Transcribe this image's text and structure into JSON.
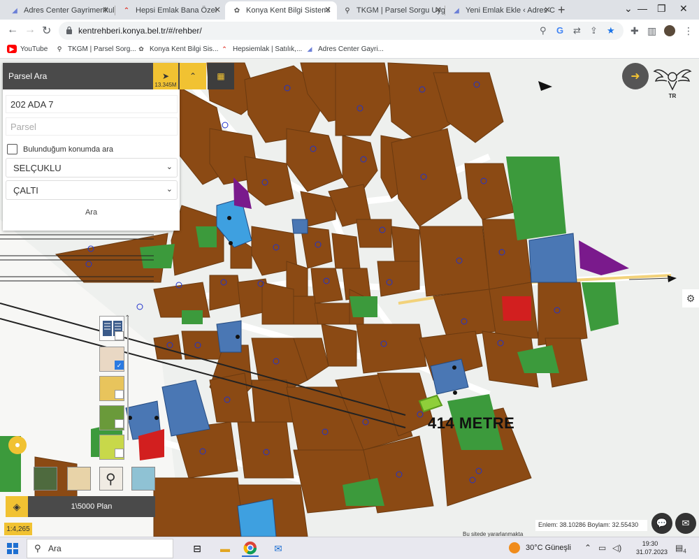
{
  "browser": {
    "tabs": [
      {
        "title": "Adres Center Gayrimenkul",
        "icon": "adres-center-favicon",
        "color": "#6b7fd7"
      },
      {
        "title": "Hepsi Emlak Bana Özel",
        "icon": "hepsiemlak-favicon",
        "color": "#e0261b"
      },
      {
        "title": "Konya Kent Bilgi Sistemi",
        "icon": "konya-favicon",
        "color": "#555555"
      },
      {
        "title": "TKGM | Parsel Sorgu Uyg",
        "icon": "location-pin-favicon",
        "color": "#333333"
      },
      {
        "title": "Yeni Emlak Ekle ‹ Adres C",
        "icon": "adres-center-favicon",
        "color": "#6b7fd7"
      }
    ],
    "active_tab": 2,
    "url": "kentrehberi.konya.bel.tr/#/rehber/",
    "bookmarks": [
      {
        "label": "YouTube",
        "icon": "youtube-icon",
        "color": "#ff0000"
      },
      {
        "label": "TKGM | Parsel Sorg...",
        "icon": "location-pin-icon",
        "color": "#222222"
      },
      {
        "label": "Konya Kent Bilgi Sis...",
        "icon": "konya-icon",
        "color": "#555555"
      },
      {
        "label": "Hepsiemlak | Satılık,...",
        "icon": "hepsiemlak-icon",
        "color": "#e0261b"
      },
      {
        "label": "Adres Center Gayri...",
        "icon": "adres-center-icon",
        "color": "#6b7fd7"
      }
    ]
  },
  "panel": {
    "title": "Parsel Ara",
    "scale_label": "13.345M",
    "ada_value": "202 ADA 7",
    "parsel_placeholder": "Parsel",
    "checkbox_label": "Bulunduğum konumda ara",
    "district": "SELÇUKLU",
    "neighborhood": "ÇALTI",
    "search_button": "Ara"
  },
  "map": {
    "distance_label": "414 METRE",
    "plan_label": "1\\5000 Plan",
    "scale_badge": "1:4,265",
    "coordinates": "Enlem: 38.10286 Boylam: 32.55430",
    "usage_text": "Bu sitede yararlanmakta",
    "emblem_text": "TR",
    "colors": {
      "parcel": "#8b4a14",
      "green": "#3c9a3c",
      "public": "#4a77b4",
      "purple": "#7a1a8c",
      "red": "#d21f1f",
      "road": "#f3f1ea",
      "accent": "#f1c232"
    }
  },
  "taskbar": {
    "search_placeholder": "Ara",
    "weather": "30°C Güneşli",
    "time": "19:30",
    "date": "31.07.2023",
    "notifications": "4"
  }
}
